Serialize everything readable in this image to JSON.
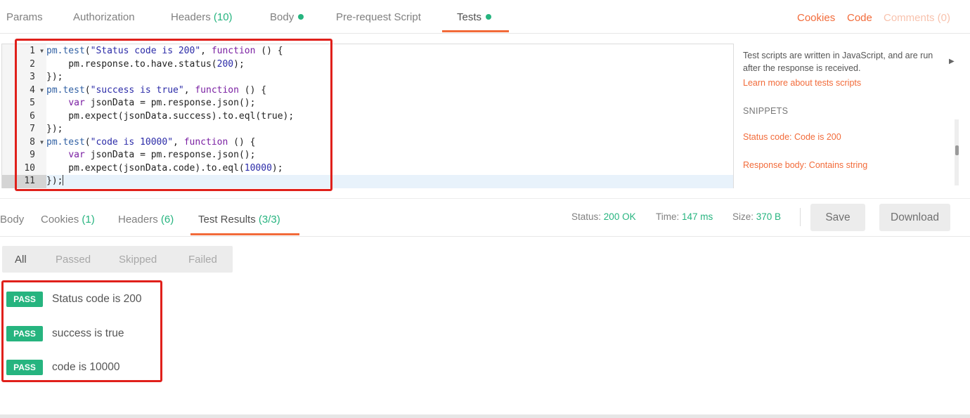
{
  "request_tabs": [
    {
      "label": "Params",
      "count": "",
      "dot": false
    },
    {
      "label": "Authorization",
      "count": "",
      "dot": false
    },
    {
      "label": "Headers",
      "count": "(10)",
      "dot": false
    },
    {
      "label": "Body",
      "count": "",
      "dot": true
    },
    {
      "label": "Pre-request Script",
      "count": "",
      "dot": false
    },
    {
      "label": "Tests",
      "count": "",
      "dot": true
    }
  ],
  "active_request_tab": "Tests",
  "top_links": {
    "cookies": "Cookies",
    "code": "Code",
    "comments": "Comments (0)"
  },
  "editor": {
    "line_numbers": [
      "1",
      "2",
      "3",
      "4",
      "5",
      "6",
      "7",
      "8",
      "9",
      "10",
      "11"
    ],
    "lines": {
      "l1_fn": "pm.test",
      "l1_open": "(",
      "l1_str": "\"Status code is 200\"",
      "l1_comma": ", ",
      "l1_kw": "function",
      "l1_end": " () {",
      "l2": "    pm.response.to.have.status(",
      "l2_num": "200",
      "l2_end": ");",
      "l3": "});",
      "l4_fn": "pm.test",
      "l4_open": "(",
      "l4_str": "\"success is true\"",
      "l4_comma": ", ",
      "l4_kw": "function",
      "l4_end": " () {",
      "l5_kw": "var",
      "l5_rest": " jsonData = pm.response.json();",
      "l6": "    pm.expect(jsonData.success).to.eql(true);",
      "l7": "});",
      "l8_fn": "pm.test",
      "l8_open": "(",
      "l8_str": "\"code is 10000\"",
      "l8_comma": ", ",
      "l8_kw": "function",
      "l8_end": " () {",
      "l9_kw": "var",
      "l9_rest": " jsonData = pm.response.json();",
      "l10": "    pm.expect(jsonData.code).to.eql(",
      "l10_num": "10000",
      "l10_end": ");",
      "l11": "});"
    }
  },
  "side_panel": {
    "description": "Test scripts are written in JavaScript, and are run after the response is received.",
    "learn_more": "Learn more about tests scripts",
    "snippets_heading": "SNIPPETS",
    "snippets": [
      "Status code: Code is 200",
      "Response body: Contains string"
    ]
  },
  "response_tabs": [
    {
      "label": "Body",
      "count": ""
    },
    {
      "label": "Cookies",
      "count": "(1)"
    },
    {
      "label": "Headers",
      "count": "(6)"
    },
    {
      "label": "Test Results",
      "count": "(3/3)"
    }
  ],
  "active_response_tab": "Test Results",
  "status": {
    "status_label": "Status:",
    "status_value": "200 OK",
    "time_label": "Time:",
    "time_value": "147 ms",
    "size_label": "Size:",
    "size_value": "370 B"
  },
  "buttons": {
    "save": "Save",
    "download": "Download"
  },
  "filters": [
    "All",
    "Passed",
    "Skipped",
    "Failed"
  ],
  "active_filter": "All",
  "results": [
    {
      "badge": "PASS",
      "label": "Status code is 200"
    },
    {
      "badge": "PASS",
      "label": "success is true"
    },
    {
      "badge": "PASS",
      "label": "code is 10000"
    }
  ],
  "colors": {
    "accent": "#f26b3a",
    "success": "#26b47f",
    "highlight_box": "#e0201b"
  }
}
